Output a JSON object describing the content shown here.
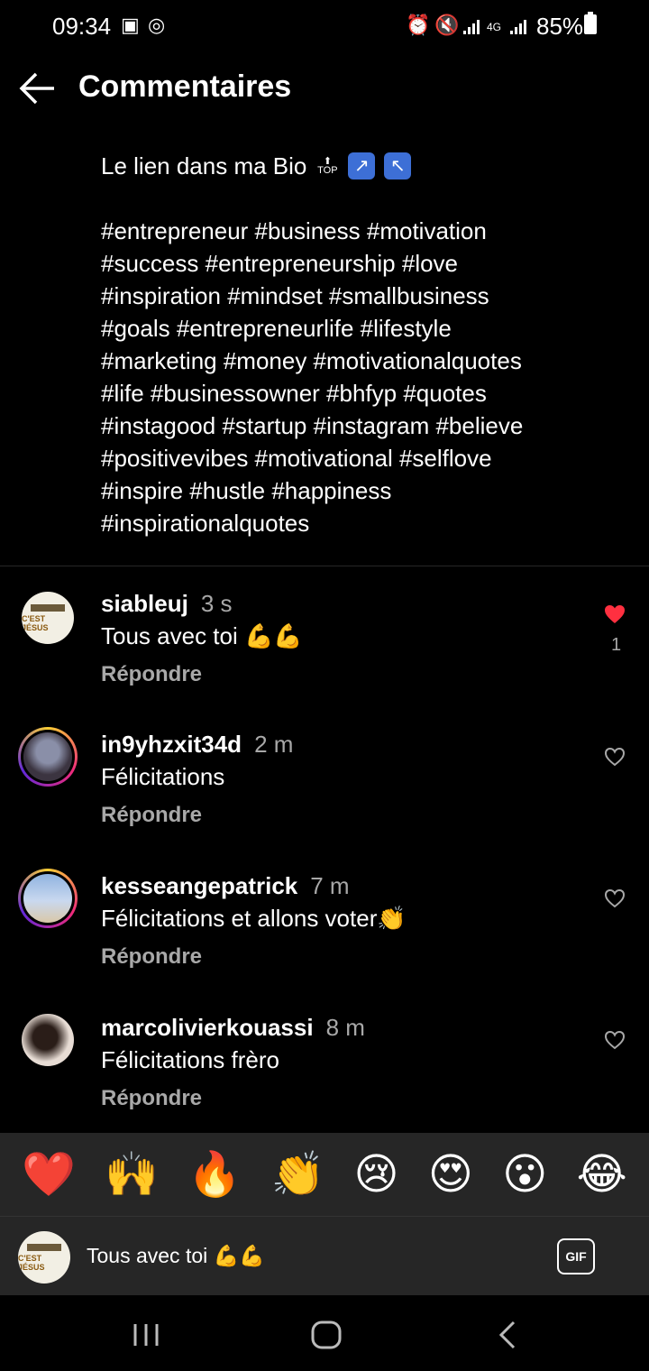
{
  "status_bar": {
    "time": "09:34",
    "battery": "85%",
    "network": "4G"
  },
  "header": {
    "title": "Commentaires"
  },
  "caption": {
    "intro": "Le lien dans ma Bio",
    "intro_emojis": [
      "top-arrow",
      "up-right-arrow",
      "up-left-arrow"
    ],
    "hashtag_lines": [
      "#entrepreneur #business #motivation",
      "#success #entrepreneurship #love",
      "#inspiration #mindset #smallbusiness",
      "#goals #entrepreneurlife #lifestyle",
      "#marketing #money #motivationalquotes",
      "#life #businessowner #bhfyp #quotes",
      "#instagood #startup #instagram #believe",
      "#positivevibes #motivational #selflove",
      "#inspire #hustle #happiness",
      "#inspirationalquotes"
    ]
  },
  "comments": [
    {
      "username": "siableuj",
      "time": "3 s",
      "text": "Tous avec toi 💪💪",
      "reply": "Répondre",
      "liked": true,
      "likes": "1"
    },
    {
      "username": "in9yhzxit34d",
      "time": "2 m",
      "text": "Félicitations",
      "reply": "Répondre",
      "liked": false
    },
    {
      "username": "kesseangepatrick",
      "time": "7 m",
      "text": "Félicitations et allons voter👏",
      "reply": "Répondre",
      "liked": false
    },
    {
      "username": "marcolivierkouassi",
      "time": "8 m",
      "text": "Félicitations frèro",
      "reply": "Répondre",
      "liked": false
    }
  ],
  "reactions": [
    "❤️",
    "🙌",
    "🔥",
    "👏",
    "😢",
    "😍",
    "😮",
    "😂"
  ],
  "input": {
    "value": "Tous avec toi 💪💪",
    "gif_label": "GIF"
  },
  "colors": {
    "background": "#000000",
    "secondary_text": "#a8a8a8",
    "like_red": "#ff3040",
    "bar_bg": "#262626"
  }
}
